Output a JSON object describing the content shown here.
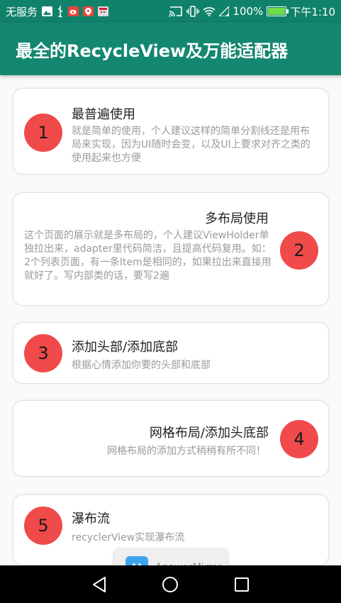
{
  "status_bar": {
    "carrier": "无服务",
    "battery": "100%",
    "battery_level": 1.0,
    "time": "下午1:10",
    "app_icons": [
      "gallery-icon",
      "usb-icon",
      "weibo-icon",
      "maps-icon",
      "calendar-icon"
    ]
  },
  "app_bar": {
    "title": "最全的RecycleView及万能适配器"
  },
  "items": [
    {
      "number": "1",
      "title": "最普遍使用",
      "desc": "就是简单的使用，个人建议这样的简单分割线还是用布局来实现，因为UI随时会变，以及UI上要求对齐之类的使用起来也方便"
    },
    {
      "number": "2",
      "title": "多布局使用",
      "desc": "这个页面的展示就是多布局的，个人建议ViewHolder单独拉出来，adapter里代码简洁，且提高代码复用。如：2个列表页面，有一条Item是相同的，如果拉出来直接用就好了。写内部类的话，要写2遍"
    },
    {
      "number": "3",
      "title": "添加头部/添加底部",
      "desc": "根据心情添加你要的头部和底部"
    },
    {
      "number": "4",
      "title": "网格布局/添加头底部",
      "desc": "网格布局的添加方式稍稍有所不同！"
    },
    {
      "number": "5",
      "title": "瀑布流",
      "desc": "recyclerView实现瀑布流"
    }
  ],
  "overlay": {
    "app_name": "ApowerMirror"
  },
  "nav": {
    "back": "back-icon",
    "home": "home-icon",
    "recents": "recents-icon"
  },
  "colors": {
    "status_bar": "#11826a",
    "app_bar": "#13876f",
    "circle": "#f04a4a",
    "desc_text": "#9a9a9a"
  }
}
